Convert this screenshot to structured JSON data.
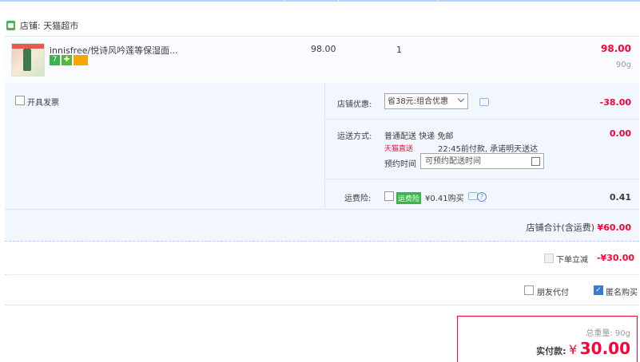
{
  "shop": {
    "label": "店铺: 天猫超市"
  },
  "item": {
    "title": "innisfree/悦诗风吟莲等保湿面...",
    "badges": [
      "7",
      "✚",
      ""
    ],
    "price": "98.00",
    "quantity": "1",
    "total": "98.00",
    "weight": "90g"
  },
  "invoice": {
    "label": "开具发票"
  },
  "discount": {
    "label": "店铺优惠:",
    "selected": "省38元:组合优惠",
    "amount": "-38.00"
  },
  "shipping": {
    "label": "运送方式:",
    "method": "普通配送 快递 免邮",
    "amount": "0.00",
    "tag": "天猫直送",
    "note": "22:45前付款, 承诺明天送达",
    "schedule_label": "预约时间",
    "schedule_placeholder": "可预约配送时间"
  },
  "insurance": {
    "label": "运费险:",
    "tag": "运费险",
    "price": "¥0.41购买",
    "amount": "0.41"
  },
  "subtotal": {
    "label": "店铺合计(含运费)",
    "amount": "¥60.00"
  },
  "instant": {
    "label": "下单立减",
    "amount": "-¥30.00"
  },
  "options": {
    "friend_pay": "朋友代付",
    "anonymous": "匿名购买"
  },
  "summary": {
    "weight_label": "总重量:",
    "weight": "90g",
    "pay_label": "实付款:",
    "currency": "¥",
    "pay_amount": "30.00"
  },
  "colors": {
    "accent": "#ff0036",
    "panel": "#f2f7ff",
    "border": "#b2d1ff",
    "check": "#3a7bd5"
  }
}
